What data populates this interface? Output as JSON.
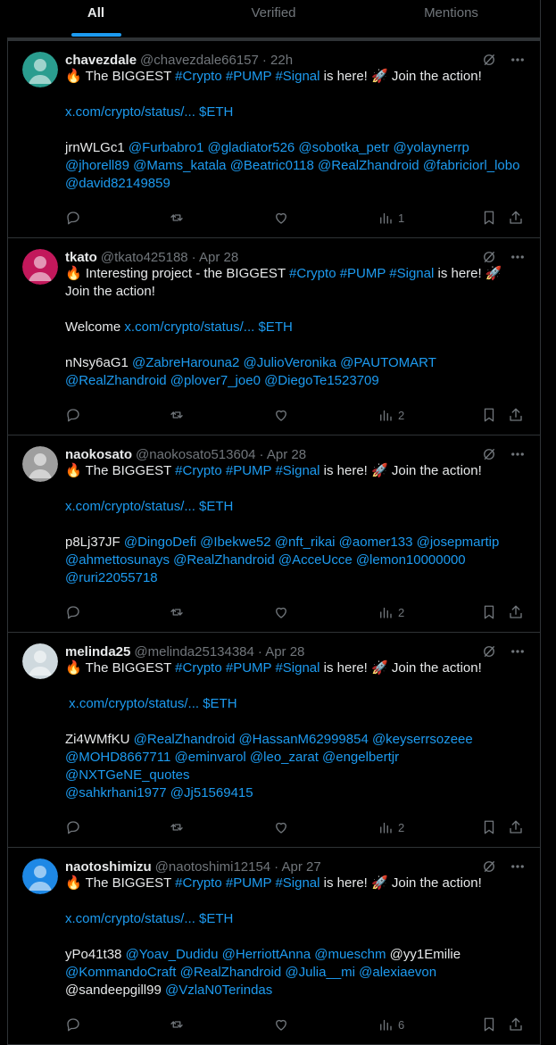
{
  "tabs": [
    {
      "label": "All",
      "active": true
    },
    {
      "label": "Verified",
      "active": false
    },
    {
      "label": "Mentions",
      "active": false
    }
  ],
  "posts": [
    {
      "username": "chavezdale",
      "handle": "@chavezdale66157",
      "time": "· 22h",
      "avatar_color": "#2a9d8f",
      "views": "1",
      "lines": [
        [
          {
            "t": "🔥 The BIGGEST "
          },
          {
            "t": "#Crypto #PUMP #Signal",
            "l": 1
          },
          {
            "t": " is here! 🚀 Join the action!"
          }
        ],
        [
          {
            "t": ""
          }
        ],
        [
          {
            "t": "x.com/crypto/status/... $ETH",
            "l": 1
          }
        ],
        [
          {
            "t": ""
          }
        ],
        [
          {
            "t": "jrnWLGc1 "
          },
          {
            "t": "@Furbabro1 @gladiator526 @sobotka_petr @yolaynerrp",
            "l": 1
          }
        ],
        [
          {
            "t": "@jhorell89 @Mams_katala @Beatric0118 @RealZhandroid @fabriciorl_lobo",
            "l": 1
          }
        ],
        [
          {
            "t": "@david82149859",
            "l": 1
          }
        ]
      ]
    },
    {
      "username": "tkato",
      "handle": "@tkato425188",
      "time": "· Apr 28",
      "avatar_color": "#c2185b",
      "views": "2",
      "lines": [
        [
          {
            "t": "🔥 Interesting project - the BIGGEST "
          },
          {
            "t": "#Crypto #PUMP #Signal",
            "l": 1
          },
          {
            "t": " is here! 🚀"
          }
        ],
        [
          {
            "t": "Join the action!"
          }
        ],
        [
          {
            "t": ""
          }
        ],
        [
          {
            "t": "Welcome "
          },
          {
            "t": "x.com/crypto/status/... $ETH",
            "l": 1
          }
        ],
        [
          {
            "t": ""
          }
        ],
        [
          {
            "t": "nNsy6aG1 "
          },
          {
            "t": "@ZabreHarouna2 @JulioVeronika @PAUTOMART",
            "l": 1
          }
        ],
        [
          {
            "t": "@RealZhandroid @plover7_joe0 @DiegoTe1523709",
            "l": 1
          }
        ]
      ]
    },
    {
      "username": "naokosato",
      "handle": "@naokosato513604",
      "time": "· Apr 28",
      "avatar_color": "#9e9e9e",
      "views": "2",
      "lines": [
        [
          {
            "t": "🔥 The BIGGEST "
          },
          {
            "t": "#Crypto #PUMP #Signal",
            "l": 1
          },
          {
            "t": " is here! 🚀 Join the action!"
          }
        ],
        [
          {
            "t": ""
          }
        ],
        [
          {
            "t": "x.com/crypto/status/... $ETH",
            "l": 1
          }
        ],
        [
          {
            "t": ""
          }
        ],
        [
          {
            "t": "p8Lj37JF "
          },
          {
            "t": "@DingoDefi @Ibekwe52 @nft_rikai @aomer133 @josepmartip",
            "l": 1
          }
        ],
        [
          {
            "t": "@ahmettosunays @RealZhandroid @AcceUcce @lemon10000000",
            "l": 1
          }
        ],
        [
          {
            "t": "@ruri22055718",
            "l": 1
          }
        ]
      ]
    },
    {
      "username": "melinda25",
      "handle": "@melinda25134384",
      "time": "· Apr 28",
      "avatar_color": "#cfd9de",
      "views": "2",
      "lines": [
        [
          {
            "t": "🔥 The BIGGEST "
          },
          {
            "t": "#Crypto #PUMP #Signal",
            "l": 1
          },
          {
            "t": " is here! 🚀 Join the action!"
          }
        ],
        [
          {
            "t": ""
          }
        ],
        [
          {
            "t": " x.com/crypto/status/... $ETH",
            "l": 1
          }
        ],
        [
          {
            "t": ""
          }
        ],
        [
          {
            "t": "Zi4WMfKU "
          },
          {
            "t": "@RealZhandroid @HassanM62999854 @keyserrsozeee",
            "l": 1
          }
        ],
        [
          {
            "t": "@MOHD8667711 @eminvarol @leo_zarat @engelbertjr @NXTGeNE_quotes",
            "l": 1
          }
        ],
        [
          {
            "t": "@sahkrhani1977 @Jj51569415",
            "l": 1
          }
        ]
      ]
    },
    {
      "username": "naotoshimizu",
      "handle": "@naotoshimi12154",
      "time": "· Apr 27",
      "avatar_color": "#1e88e5",
      "views": "6",
      "lines": [
        [
          {
            "t": "🔥 The BIGGEST "
          },
          {
            "t": "#Crypto #PUMP #Signal",
            "l": 1
          },
          {
            "t": " is here! 🚀 Join the action!"
          }
        ],
        [
          {
            "t": ""
          }
        ],
        [
          {
            "t": "x.com/crypto/status/... $ETH",
            "l": 1
          }
        ],
        [
          {
            "t": ""
          }
        ],
        [
          {
            "t": "yPo41t38 "
          },
          {
            "t": "@Yoav_Dudidu @HerriottAnna @mueschm",
            "l": 1
          },
          {
            "t": " @yy1Emilie"
          }
        ],
        [
          {
            "t": "@KommandoCraft @RealZhandroid @Julia__mi @alexiaevon",
            "l": 1
          }
        ],
        [
          {
            "t": "@sandeepgill99 "
          },
          {
            "t": "@VzlaN0Terindas",
            "l": 1
          }
        ]
      ]
    }
  ]
}
